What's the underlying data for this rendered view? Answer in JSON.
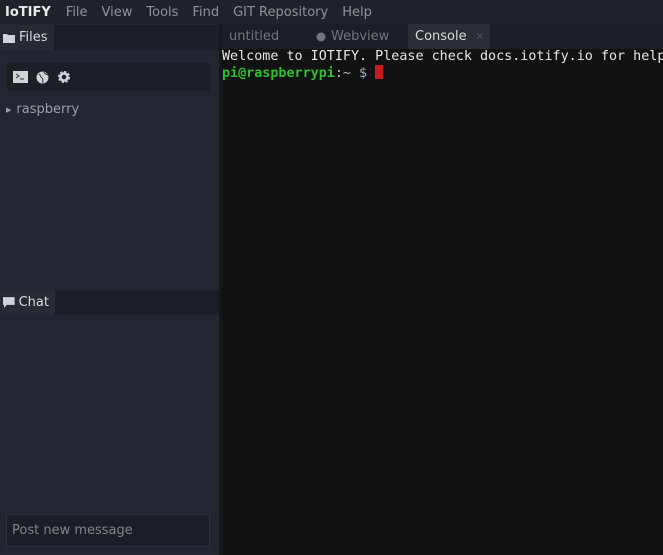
{
  "menubar": {
    "brand": "IoTIFY",
    "items": [
      "File",
      "View",
      "Tools",
      "Find",
      "GIT Repository",
      "Help"
    ]
  },
  "files_panel": {
    "title": "Files",
    "tree": [
      {
        "label": "raspberry"
      }
    ]
  },
  "chat_panel": {
    "title": "Chat",
    "input_placeholder": "Post new message"
  },
  "tabs": [
    {
      "label": "untitled"
    },
    {
      "label": "Webview"
    },
    {
      "label": "Console",
      "close": "×"
    }
  ],
  "terminal": {
    "welcome": "Welcome to IOTIFY. Please check docs.iotify.io for help.",
    "prompt_user": "pi@raspberrypi",
    "prompt_path": ":~",
    "prompt_symbol": " $ "
  },
  "colors": {
    "prompt": "#2fc02f",
    "cursor": "#c41a1a"
  }
}
